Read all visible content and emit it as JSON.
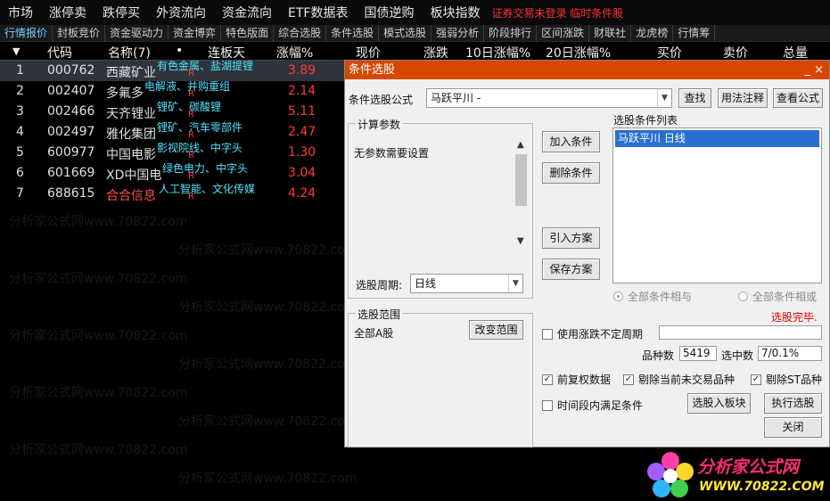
{
  "menu": [
    "市场",
    "涨停卖",
    "跌停买",
    "外资流向",
    "资金流向",
    "ETF数据表",
    "国债逆购",
    "板块指数"
  ],
  "menu_warning": "证券交易未登录  临时条件股",
  "tabs": [
    "行情报价",
    "封板竞价",
    "资金驱动力",
    "资金博弈",
    "特色版面",
    "综合选股",
    "条件选股",
    "模式选股",
    "强弱分析",
    "阶段排行",
    "区间涨跌",
    "财联社",
    "龙虎榜",
    "行情筹"
  ],
  "columns": {
    "sort_icon": "▼",
    "code": "代码",
    "name": "名称(7)",
    "dot": "•",
    "board": "连板天",
    "pct": "涨幅%",
    "price": "现价",
    "change": "涨跌",
    "pct10": "10日涨幅%",
    "pct20": "20日涨幅%",
    "buy": "买价",
    "sell": "卖价",
    "total": "总量"
  },
  "rows": [
    {
      "num": "1",
      "code": "000762",
      "name": "西藏矿业",
      "tag": "有色金属、盐湖提锂",
      "r": "R",
      "pct": "3.89"
    },
    {
      "num": "2",
      "code": "002407",
      "name": "多氟多",
      "tag": "电解液、并购重组",
      "r": "R",
      "pct": "2.14"
    },
    {
      "num": "3",
      "code": "002466",
      "name": "天齐锂业",
      "tag": "锂矿、碳酸锂",
      "r": "R",
      "pct": "5.11"
    },
    {
      "num": "4",
      "code": "002497",
      "name": "雅化集团",
      "tag": "锂矿、汽车零部件",
      "r": "R",
      "pct": "2.47"
    },
    {
      "num": "5",
      "code": "600977",
      "name": "中国电影",
      "tag": "影视院线、中字头",
      "r": "R",
      "pct": "1.30"
    },
    {
      "num": "6",
      "code": "601669",
      "name": "XD中国电",
      "tag": "绿色电力、中字头",
      "r": "R",
      "pct": "3.04"
    },
    {
      "num": "7",
      "code": "688615",
      "name": "合合信息",
      "tag": "人工智能、文化传媒",
      "r": "R",
      "pct": "4.24"
    }
  ],
  "watermark": "分析家公式网www.70822.com",
  "dialog": {
    "title": "条件选股",
    "title_controls": "_  ×",
    "formula_label": "条件选股公式",
    "formula_value": "马跃平川  -",
    "find_btn": "查找",
    "usage_btn": "用法注释",
    "view_btn": "查看公式",
    "params_group": "计算参数",
    "params_text": "无参数需要设置",
    "period_label": "选股周期:",
    "period_value": "日线",
    "scope_group": "选股范围",
    "scope_value": "全部A股",
    "scope_btn": "改变范围",
    "add_btn": "加入条件",
    "del_btn": "删除条件",
    "import_btn": "引入方案",
    "save_btn": "保存方案",
    "list_label": "选股条件列表",
    "list_items": [
      "马跃平川  日线"
    ],
    "radio_and": "全部条件相与",
    "radio_or": "全部条件相或",
    "status": "选股完毕.",
    "use_period_label": "使用涨跌不定周期",
    "count_label": "品种数",
    "count_value": "5419",
    "selected_label": "选中数",
    "selected_value": "7/0.1%",
    "fq_label": "前复权数据",
    "exclude_nt_label": "剔除当前未交易品种",
    "exclude_st_label": "剔除ST品种",
    "time_label": "时间段内满足条件",
    "to_board_btn": "选股入板块",
    "exec_btn": "执行选股",
    "close_btn": "关闭"
  },
  "logo": {
    "line1": "分析家公式网",
    "line2": "WWW.70822.COM"
  }
}
